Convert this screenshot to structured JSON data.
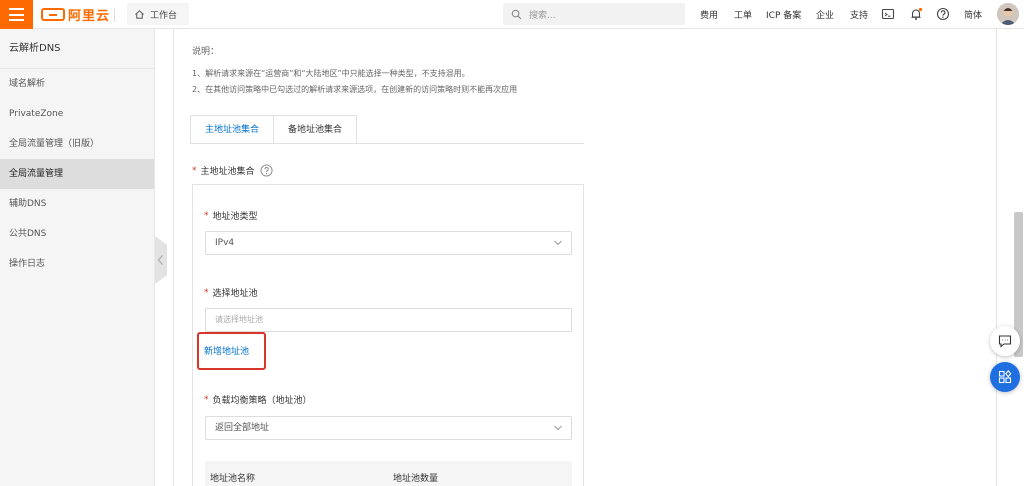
{
  "topbar": {
    "logo_text": "阿里云",
    "workbench_label": "工作台",
    "search_placeholder": "搜索...",
    "nav": [
      "费用",
      "工单",
      "ICP 备案",
      "企业",
      "支持",
      "简体"
    ]
  },
  "sidebar": {
    "title": "云解析DNS",
    "items": [
      {
        "label": "域名解析"
      },
      {
        "label": "PrivateZone"
      },
      {
        "label": "全局流量管理（旧版）"
      },
      {
        "label": "全局流量管理"
      },
      {
        "label": "辅助DNS"
      },
      {
        "label": "公共DNS"
      },
      {
        "label": "操作日志"
      }
    ]
  },
  "main": {
    "desc_title": "说明：",
    "desc_lines": [
      "1、解析请求来源在“运营商”和“大陆地区”中只能选择一种类型，不支持混用。",
      "2、在其他访问策略中已勾选过的解析请求来源选项，在创建新的访问策略时则不能再次应用"
    ],
    "tabs": [
      "主地址池集合",
      "备地址池集合"
    ],
    "primary_pool_label": "主地址池集合",
    "pool_type_label": "地址池类型",
    "pool_type_value": "IPv4",
    "select_pool_label": "选择地址池",
    "select_pool_placeholder": "请选择地址池",
    "new_pool_link": "新增地址池",
    "lb_strategy_label": "负载均衡策略（地址池）",
    "lb_strategy_value": "返回全部地址",
    "table_headers": [
      "地址池名称",
      "地址池数量"
    ]
  },
  "colors": {
    "brand": "#ff6a00",
    "link": "#0070cc",
    "highlight": "#d9362b",
    "required": "#d93026"
  }
}
